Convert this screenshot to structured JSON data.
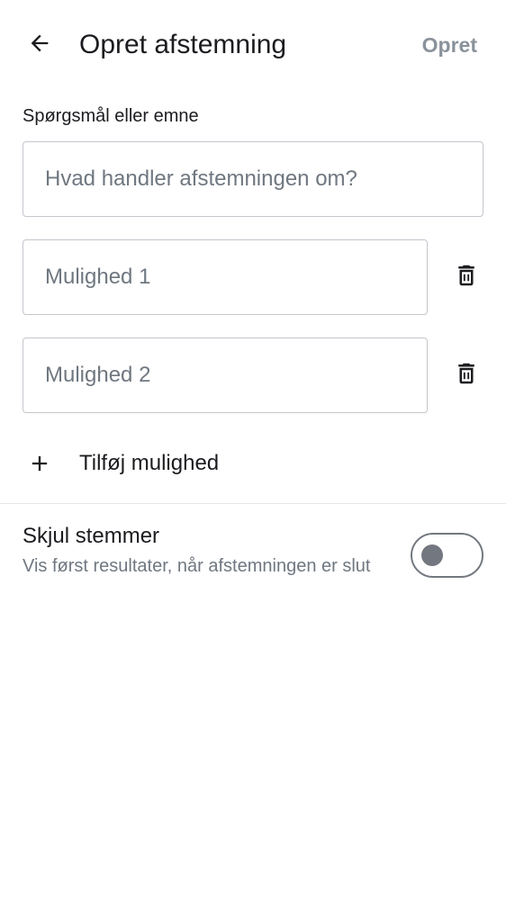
{
  "header": {
    "back_icon": "arrow-back-icon",
    "title": "Opret afstemning",
    "create_label": "Opret"
  },
  "question": {
    "label": "Spørgsmål eller emne",
    "placeholder": "Hvad handler afstemningen om?",
    "value": ""
  },
  "options": [
    {
      "placeholder": "Mulighed 1",
      "value": "",
      "delete_icon": "trash-icon"
    },
    {
      "placeholder": "Mulighed 2",
      "value": "",
      "delete_icon": "trash-icon"
    }
  ],
  "add_option": {
    "icon": "plus-icon",
    "label": "Tilføj mulighed"
  },
  "hide_votes": {
    "title": "Skjul stemmer",
    "description": "Vis først resultater, når afstemningen er slut",
    "enabled": false
  },
  "colors": {
    "text_primary": "#1c1b1f",
    "text_secondary": "#6f7780",
    "disabled_action": "#8a929b",
    "field_border": "#c4c6cc",
    "switch_off": "#737880"
  }
}
